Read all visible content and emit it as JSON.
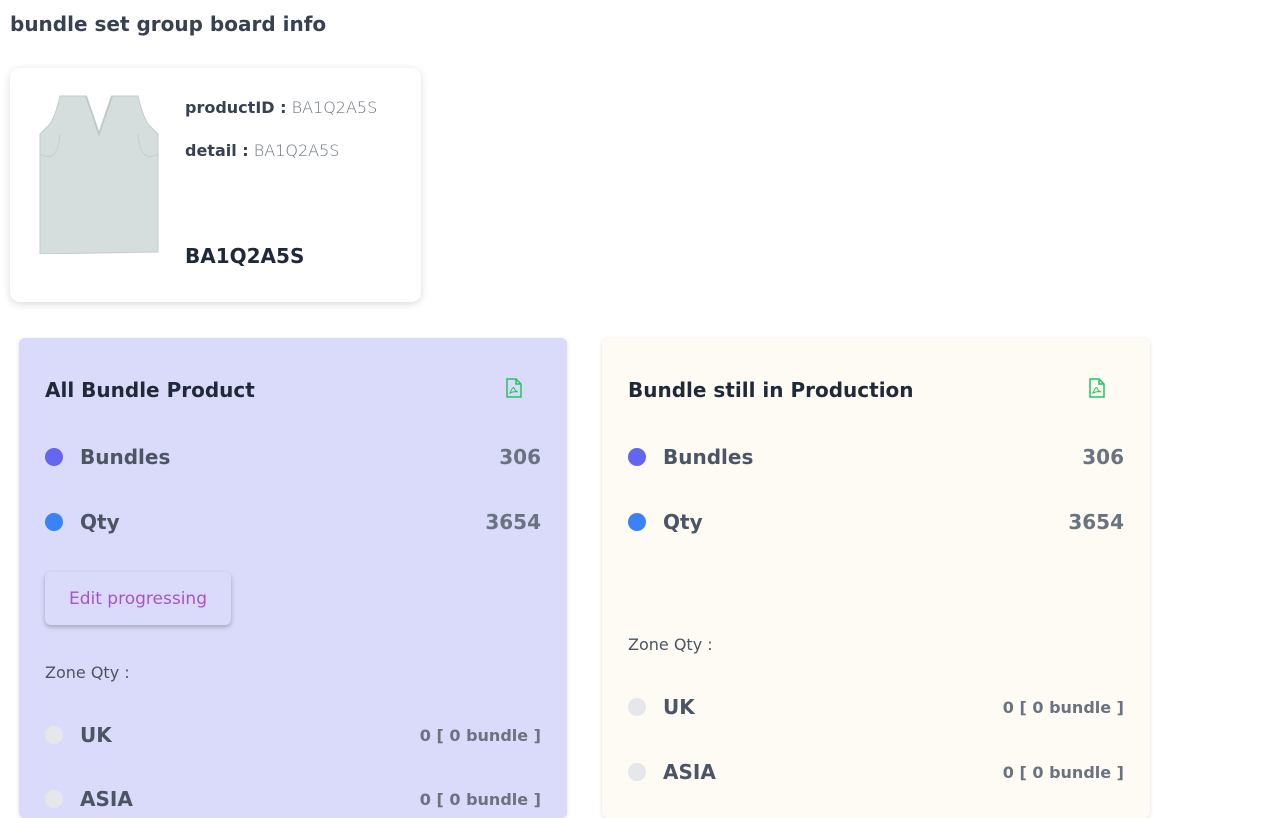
{
  "page": {
    "title": "bundle set group board info"
  },
  "product": {
    "product_id_label": "productID :",
    "product_id_value": "BA1Q2A5S",
    "detail_label": "detail :",
    "detail_value": "BA1Q2A5S",
    "code": "BA1Q2A5S",
    "image": "sleeveless-vest-image"
  },
  "colors": {
    "bundles_dot": "#6366f1",
    "qty_dot": "#3b82f6",
    "pdf_icon": "#22c55e",
    "left_panel_bg": "#dadafa",
    "right_panel_bg": "#fdfbf3"
  },
  "panels": [
    {
      "title": "All Bundle Product",
      "icon": "pdf-file-icon",
      "stats": [
        {
          "label": "Bundles",
          "value": "306"
        },
        {
          "label": "Qty",
          "value": "3654"
        }
      ],
      "button_label": "Edit progressing",
      "zone_heading": "Zone Qty :",
      "zones": [
        {
          "label": "UK",
          "value": "0 [ 0 bundle ]"
        },
        {
          "label": "ASIA",
          "value": "0 [ 0 bundle ]"
        }
      ]
    },
    {
      "title": "Bundle still in Production",
      "icon": "pdf-file-icon",
      "stats": [
        {
          "label": "Bundles",
          "value": "306"
        },
        {
          "label": "Qty",
          "value": "3654"
        }
      ],
      "zone_heading": "Zone Qty :",
      "zones": [
        {
          "label": "UK",
          "value": "0 [ 0 bundle ]"
        },
        {
          "label": "ASIA",
          "value": "0 [ 0 bundle ]"
        }
      ]
    }
  ]
}
